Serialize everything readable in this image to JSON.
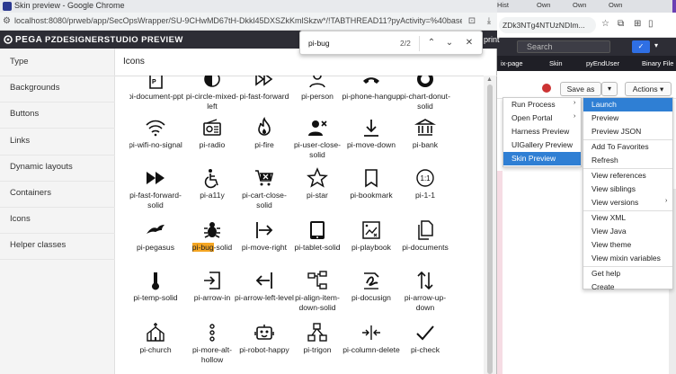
{
  "popup": {
    "window_title": "Skin preview - Google Chrome",
    "url": "localhost:8080/prweb/app/SecOpsWrapper/SU-9CHwMD67tH-Dkkl45DXSZkKmlSkzw*/!TABTHREAD11?pyActivity=%40baseclass.pzProce...",
    "brand": "PEGA",
    "studio": "PZDESIGNERSTUDIO PREVIEW",
    "print_label": "print"
  },
  "find": {
    "query": "pi-bug",
    "count": "2/2"
  },
  "sidebar": {
    "items": [
      {
        "label": "Type"
      },
      {
        "label": "Backgrounds"
      },
      {
        "label": "Buttons"
      },
      {
        "label": "Links"
      },
      {
        "label": "Dynamic layouts"
      },
      {
        "label": "Containers"
      },
      {
        "label": "Icons"
      },
      {
        "label": "Helper classes"
      }
    ]
  },
  "main": {
    "title": "Icons",
    "icons": [
      {
        "name": "pi-document-ppt",
        "icon": "doc-ppt"
      },
      {
        "name": "pi-circle-mixed-left",
        "icon": "circle-mixed"
      },
      {
        "name": "pi-fast-forward",
        "icon": "fast-forward-outline"
      },
      {
        "name": "pi-person",
        "icon": "person"
      },
      {
        "name": "pi-phone-hangup",
        "icon": "phone"
      },
      {
        "name": "pi-chart-donut-solid",
        "icon": "donut"
      },
      {
        "name": "pi-wifi-no-signal",
        "icon": "wifi"
      },
      {
        "name": "pi-radio",
        "icon": "radio"
      },
      {
        "name": "pi-fire",
        "icon": "fire"
      },
      {
        "name": "pi-user-close-solid",
        "icon": "user-close"
      },
      {
        "name": "pi-move-down",
        "icon": "move-down"
      },
      {
        "name": "pi-bank",
        "icon": "bank"
      },
      {
        "name": "pi-fast-forward-solid",
        "icon": "fast-forward-solid"
      },
      {
        "name": "pi-a11y",
        "icon": "a11y"
      },
      {
        "name": "pi-cart-close-solid",
        "icon": "cart"
      },
      {
        "name": "pi-star",
        "icon": "star"
      },
      {
        "name": "pi-bookmark",
        "icon": "bookmark"
      },
      {
        "name": "pi-1-1",
        "icon": "one-one"
      },
      {
        "name": "pi-pegasus",
        "icon": "pegasus"
      },
      {
        "name": "pi-bug-solid",
        "icon": "bug",
        "highlight": "pi-bug"
      },
      {
        "name": "pi-move-right",
        "icon": "move-right"
      },
      {
        "name": "pi-tablet-solid",
        "icon": "tablet"
      },
      {
        "name": "pi-playbook",
        "icon": "playbook"
      },
      {
        "name": "pi-documents",
        "icon": "documents"
      },
      {
        "name": "pi-temp-solid",
        "icon": "temp"
      },
      {
        "name": "pi-arrow-in",
        "icon": "arrow-in"
      },
      {
        "name": "pi-arrow-left-level",
        "icon": "arrow-left-level"
      },
      {
        "name": "pi-align-item-down-solid",
        "icon": "align-down"
      },
      {
        "name": "pi-docusign",
        "icon": "docusign"
      },
      {
        "name": "pi-arrow-up-down",
        "icon": "arrow-up-down"
      },
      {
        "name": "pi-church",
        "icon": "church"
      },
      {
        "name": "pi-more-alt-hollow",
        "icon": "more-alt"
      },
      {
        "name": "pi-robot-happy",
        "icon": "robot"
      },
      {
        "name": "pi-trigon",
        "icon": "trigon"
      },
      {
        "name": "pi-column-delete",
        "icon": "column-delete"
      },
      {
        "name": "pi-check",
        "icon": "check"
      }
    ]
  },
  "background": {
    "tabs": [
      "Hist",
      "Own",
      "Own",
      "Own"
    ],
    "url": "ZDk3NTg4NTUzNDIm...",
    "search_placeholder": "Search",
    "nav": [
      "ix-page",
      "Skin",
      "pyEndUser",
      "Binary File"
    ],
    "save_as": "Save as",
    "actions": "Actions",
    "run_menu": [
      {
        "label": "Run Process",
        "submenu": true
      },
      {
        "label": "Open Portal",
        "submenu": true
      },
      {
        "label": "Harness Preview"
      },
      {
        "label": "UIGallery Preview"
      },
      {
        "label": "Skin Preview",
        "active": true
      }
    ],
    "actions_menu": [
      {
        "label": "Launch",
        "active": true
      },
      {
        "label": "Preview"
      },
      {
        "label": "Preview JSON"
      },
      {
        "sep": true
      },
      {
        "label": "Add To Favorites"
      },
      {
        "label": "Refresh"
      },
      {
        "sep": true
      },
      {
        "label": "View references"
      },
      {
        "label": "View siblings"
      },
      {
        "label": "View versions",
        "submenu": true
      },
      {
        "sep": true
      },
      {
        "label": "View XML"
      },
      {
        "label": "View Java"
      },
      {
        "label": "View theme"
      },
      {
        "label": "View mixin variables"
      },
      {
        "sep": true
      },
      {
        "label": "Get help"
      },
      {
        "label": "Create"
      }
    ]
  }
}
